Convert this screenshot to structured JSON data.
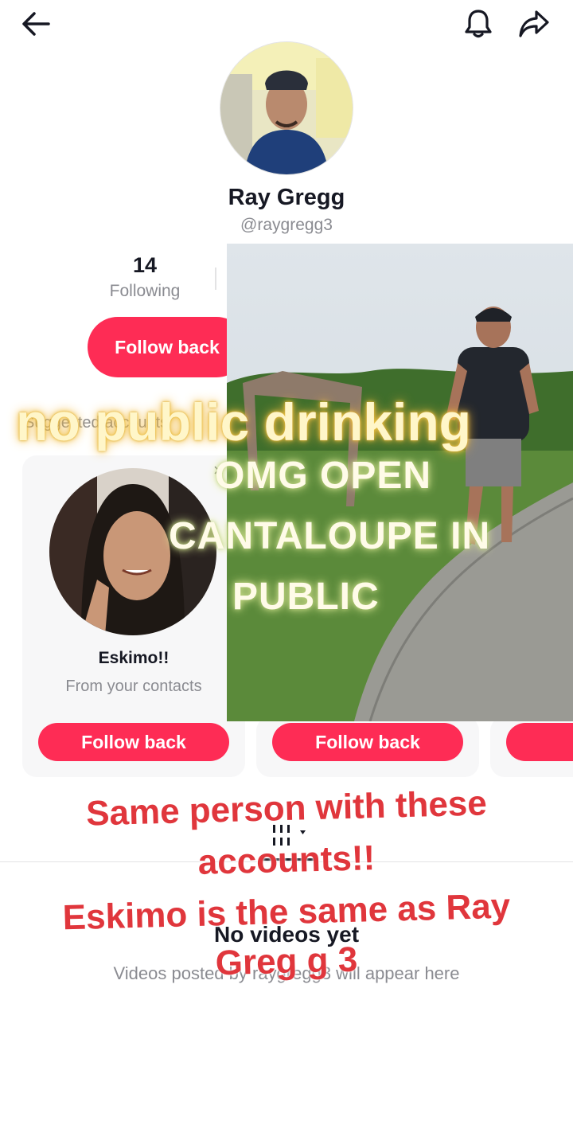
{
  "profile": {
    "name": "Ray Gregg",
    "handle": "@raygregg3",
    "following_count": "14",
    "following_label": "Following",
    "follow_back_label": "Follow back"
  },
  "suggested": {
    "header": "Suggested accounts",
    "cards": [
      {
        "name": "Eskimo!!",
        "subtitle": "From your contacts",
        "button": "Follow back"
      },
      {
        "name": "",
        "subtitle": "",
        "button": "Follow back"
      }
    ]
  },
  "videos": {
    "empty_title": "No videos yet",
    "empty_subtitle": "Videos posted by raygregg3 will appear here"
  },
  "overlay": {
    "yellow_caption": "no public drinking",
    "video_caption_line1": "OMG OPEN",
    "video_caption_line2": "CANTALOUPE IN",
    "video_caption_line3": "PUBLIC",
    "red_caption_line1": "Same person with these",
    "red_caption_line2": "accounts!!",
    "red_caption_line3": "Eskimo is the same as Ray",
    "red_caption_line4": "Greg g 3"
  },
  "colors": {
    "accent": "#fe2c55",
    "caption_red": "#e0363c",
    "caption_yellow": "#fff6c9"
  }
}
